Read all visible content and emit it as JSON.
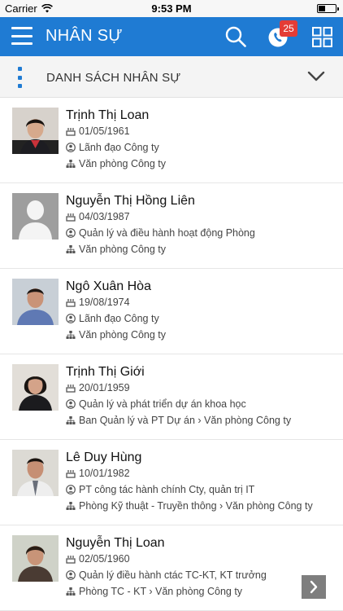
{
  "status_bar": {
    "carrier": "Carrier",
    "time": "9:53 PM"
  },
  "header": {
    "title": "NHÂN SỰ",
    "notification_count": "25"
  },
  "section": {
    "title": "DANH SÁCH NHÂN SỰ"
  },
  "employees": [
    {
      "name": "Trịnh Thị Loan",
      "birthdate": "01/05/1961",
      "position": "Lãnh đạo Công ty",
      "department": "Văn phòng Công ty"
    },
    {
      "name": "Nguyễn Thị Hồng Liên",
      "birthdate": "04/03/1987",
      "position": "Quản lý và điều hành hoạt động Phòng",
      "department": "Văn phòng Công ty"
    },
    {
      "name": "Ngô Xuân Hòa",
      "birthdate": "19/08/1974",
      "position": "Lãnh đạo Công ty",
      "department": "Văn phòng Công ty"
    },
    {
      "name": "Trịnh Thị Giới",
      "birthdate": "20/01/1959",
      "position": "Quản lý và phát triển dự án khoa học",
      "department": "Ban Quản lý và PT Dự án › Văn phòng Công ty"
    },
    {
      "name": "Lê Duy Hùng",
      "birthdate": "10/01/1982",
      "position": "PT công tác hành chính Cty, quản trị IT",
      "department": "Phòng Kỹ thuật - Truyền thông › Văn phòng Công ty"
    },
    {
      "name": "Nguyễn Thị Loan",
      "birthdate": "02/05/1960",
      "position": "Quản lý điều hành ctác TC-KT, KT trưởng",
      "department": "Phòng TC - KT › Văn phòng Công ty"
    }
  ],
  "colors": {
    "header": "#1f7bd3",
    "badge": "#e43c36",
    "section_bg": "#f4f4f4"
  }
}
